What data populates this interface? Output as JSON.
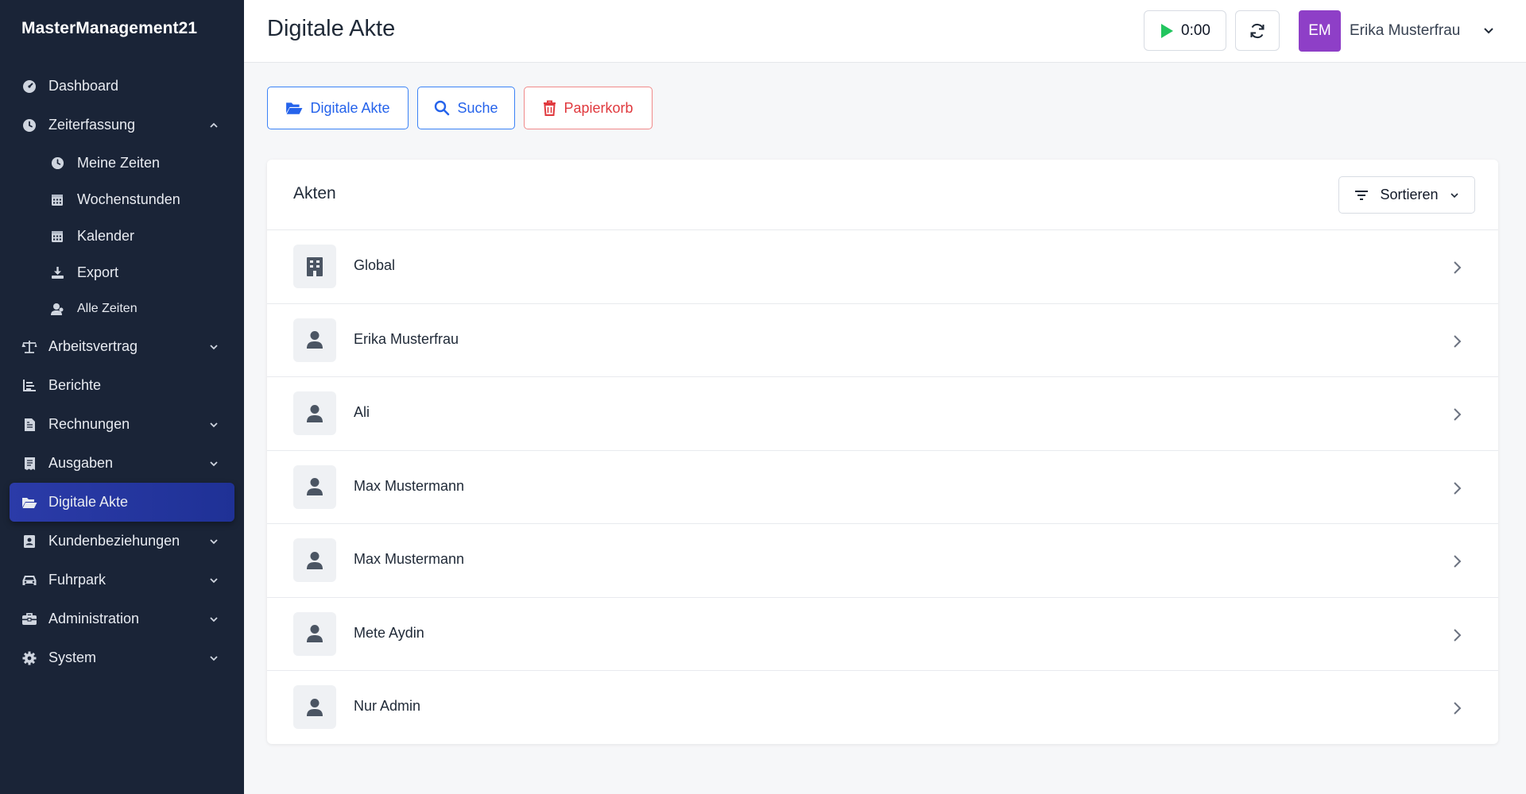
{
  "app": {
    "brand": "MasterManagement21"
  },
  "sidebar": {
    "items": [
      {
        "label": "Dashboard",
        "icon": "dashboard-icon"
      },
      {
        "label": "Zeiterfassung",
        "icon": "clock-icon",
        "expanded": true,
        "children": [
          {
            "label": "Meine Zeiten",
            "icon": "clock-icon"
          },
          {
            "label": "Wochenstunden",
            "icon": "calendar-icon"
          },
          {
            "label": "Kalender",
            "icon": "calendar-icon"
          },
          {
            "label": "Export",
            "icon": "download-icon"
          },
          {
            "label": "Alle Zeiten",
            "icon": "users-icon"
          }
        ]
      },
      {
        "label": "Arbeitsvertrag",
        "icon": "scale-icon"
      },
      {
        "label": "Berichte",
        "icon": "chart-icon"
      },
      {
        "label": "Rechnungen",
        "icon": "invoice-icon"
      },
      {
        "label": "Ausgaben",
        "icon": "receipt-icon"
      },
      {
        "label": "Digitale Akte",
        "icon": "folder-open-icon",
        "active": true
      },
      {
        "label": "Kundenbeziehungen",
        "icon": "contact-book-icon"
      },
      {
        "label": "Fuhrpark",
        "icon": "car-icon"
      },
      {
        "label": "Administration",
        "icon": "toolbox-icon"
      },
      {
        "label": "System",
        "icon": "gear-icon"
      }
    ]
  },
  "header": {
    "title": "Digitale Akte",
    "timer": "0:00",
    "user": {
      "initials": "EM",
      "name": "Erika Musterfrau",
      "avatar_color": "#8e3fc7"
    }
  },
  "actions": {
    "akte": "Digitale Akte",
    "suche": "Suche",
    "papierkorb": "Papierkorb"
  },
  "card": {
    "title": "Akten",
    "sort_label": "Sortieren",
    "rows": [
      {
        "label": "Global",
        "icon": "building-icon"
      },
      {
        "label": "Erika Musterfrau",
        "icon": "user-icon"
      },
      {
        "label": "Ali",
        "icon": "user-icon"
      },
      {
        "label": "Max Mustermann",
        "icon": "user-icon"
      },
      {
        "label": "Max Mustermann",
        "icon": "user-icon"
      },
      {
        "label": "Mete Aydin",
        "icon": "user-icon"
      },
      {
        "label": "Nur Admin",
        "icon": "user-icon"
      }
    ]
  },
  "colors": {
    "sidebar_bg": "#1a2437",
    "active_nav": "#2b3ba8",
    "primary": "#2563eb",
    "danger": "#e0393e",
    "play": "#22c55e"
  }
}
